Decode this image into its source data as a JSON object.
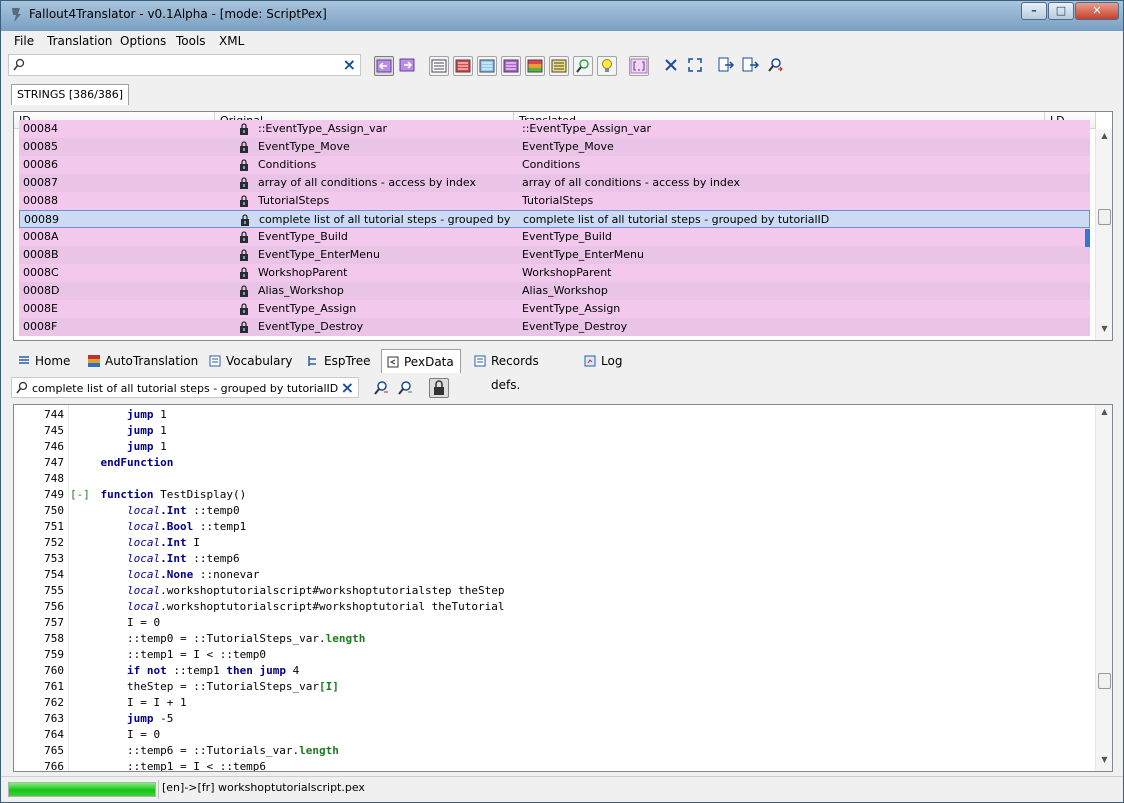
{
  "window": {
    "title": "Fallout4Translator - v0.1Alpha - [mode: ScriptPex]"
  },
  "menu": [
    "File",
    "Translation",
    "Options",
    "Tools",
    "XML"
  ],
  "search": {
    "value": "",
    "placeholder": ""
  },
  "strings_tab": "STRINGS [386/386]",
  "grid": {
    "columns": [
      "ID",
      "Original",
      "Translated",
      "LD"
    ],
    "rows": [
      {
        "id": "00084",
        "original": "::EventType_Assign_var",
        "translated": "::EventType_Assign_var"
      },
      {
        "id": "00085",
        "original": "EventType_Move",
        "translated": "EventType_Move"
      },
      {
        "id": "00086",
        "original": "Conditions",
        "translated": "Conditions"
      },
      {
        "id": "00087",
        "original": "array of all conditions - access by index",
        "translated": "array of all conditions - access by index"
      },
      {
        "id": "00088",
        "original": "TutorialSteps",
        "translated": "TutorialSteps"
      },
      {
        "id": "00089",
        "original": "complete list of all tutorial steps - grouped by tut...",
        "translated": "complete list of all tutorial steps - grouped by tutorialID"
      },
      {
        "id": "0008A",
        "original": "EventType_Build",
        "translated": "EventType_Build"
      },
      {
        "id": "0008B",
        "original": "EventType_EnterMenu",
        "translated": "EventType_EnterMenu"
      },
      {
        "id": "0008C",
        "original": "WorkshopParent",
        "translated": "WorkshopParent"
      },
      {
        "id": "0008D",
        "original": "Alias_Workshop",
        "translated": "Alias_Workshop"
      },
      {
        "id": "0008E",
        "original": "EventType_Assign",
        "translated": "EventType_Assign"
      },
      {
        "id": "0008F",
        "original": "EventType_Destroy",
        "translated": "EventType_Destroy"
      }
    ],
    "selected_id": "00089"
  },
  "tabs": [
    {
      "label": "Home",
      "icon": "home-icon"
    },
    {
      "label": "AutoTranslation",
      "icon": "autotranslation-icon"
    },
    {
      "label": "Vocabulary",
      "icon": "vocabulary-icon"
    },
    {
      "label": "EspTree",
      "icon": "esptree-icon"
    },
    {
      "label": "PexData",
      "icon": "pexdata-icon"
    },
    {
      "label": "Records defs.",
      "icon": "records-icon"
    },
    {
      "label": "Log",
      "icon": "log-icon"
    }
  ],
  "active_tab": "PexData",
  "pex_search": {
    "value": "complete list of all tutorial steps - grouped by tutorialID"
  },
  "code": [
    {
      "n": "744",
      "fold": "",
      "segs": [
        [
          "p",
          "        "
        ],
        [
          "k",
          "jump"
        ],
        [
          "p",
          " 1"
        ]
      ]
    },
    {
      "n": "745",
      "fold": "",
      "segs": [
        [
          "p",
          "        "
        ],
        [
          "k",
          "jump"
        ],
        [
          "p",
          " 1"
        ]
      ]
    },
    {
      "n": "746",
      "fold": "",
      "segs": [
        [
          "p",
          "        "
        ],
        [
          "k",
          "jump"
        ],
        [
          "p",
          " 1"
        ]
      ]
    },
    {
      "n": "747",
      "fold": "",
      "segs": [
        [
          "p",
          "    "
        ],
        [
          "k",
          "endFunction"
        ]
      ]
    },
    {
      "n": "748",
      "fold": "",
      "segs": []
    },
    {
      "n": "749",
      "fold": "[-]",
      "segs": [
        [
          "p",
          "    "
        ],
        [
          "k",
          "function"
        ],
        [
          "p",
          " TestDisplay()"
        ]
      ]
    },
    {
      "n": "750",
      "fold": "",
      "segs": [
        [
          "p",
          "        "
        ],
        [
          "i",
          "local"
        ],
        [
          "k",
          ".Int"
        ],
        [
          "p",
          " ::temp0"
        ]
      ]
    },
    {
      "n": "751",
      "fold": "",
      "segs": [
        [
          "p",
          "        "
        ],
        [
          "i",
          "local"
        ],
        [
          "k",
          ".Bool"
        ],
        [
          "p",
          " ::temp1"
        ]
      ]
    },
    {
      "n": "752",
      "fold": "",
      "segs": [
        [
          "p",
          "        "
        ],
        [
          "i",
          "local"
        ],
        [
          "k",
          ".Int"
        ],
        [
          "p",
          " I"
        ]
      ]
    },
    {
      "n": "753",
      "fold": "",
      "segs": [
        [
          "p",
          "        "
        ],
        [
          "i",
          "local"
        ],
        [
          "k",
          ".Int"
        ],
        [
          "p",
          " ::temp6"
        ]
      ]
    },
    {
      "n": "754",
      "fold": "",
      "segs": [
        [
          "p",
          "        "
        ],
        [
          "i",
          "local"
        ],
        [
          "k",
          ".None"
        ],
        [
          "p",
          " ::nonevar"
        ]
      ]
    },
    {
      "n": "755",
      "fold": "",
      "segs": [
        [
          "p",
          "        "
        ],
        [
          "i",
          "local"
        ],
        [
          "p",
          ".workshoptutorialscript#workshoptutorialstep theStep"
        ]
      ]
    },
    {
      "n": "756",
      "fold": "",
      "segs": [
        [
          "p",
          "        "
        ],
        [
          "i",
          "local"
        ],
        [
          "p",
          ".workshoptutorialscript#workshoptutorial theTutorial"
        ]
      ]
    },
    {
      "n": "757",
      "fold": "",
      "segs": [
        [
          "p",
          "        I = 0"
        ]
      ]
    },
    {
      "n": "758",
      "fold": "",
      "segs": [
        [
          "p",
          "        ::temp0 = ::TutorialSteps_var."
        ],
        [
          "g",
          "length"
        ]
      ]
    },
    {
      "n": "759",
      "fold": "",
      "segs": [
        [
          "p",
          "        ::temp1 = I < ::temp0"
        ]
      ]
    },
    {
      "n": "760",
      "fold": "",
      "segs": [
        [
          "p",
          "        "
        ],
        [
          "k",
          "if not"
        ],
        [
          "p",
          " ::temp1 "
        ],
        [
          "k",
          "then jump"
        ],
        [
          "p",
          " 4"
        ]
      ]
    },
    {
      "n": "761",
      "fold": "",
      "segs": [
        [
          "p",
          "        theStep = ::TutorialSteps_var"
        ],
        [
          "g",
          "[I]"
        ]
      ]
    },
    {
      "n": "762",
      "fold": "",
      "segs": [
        [
          "p",
          "        I = I + 1"
        ]
      ]
    },
    {
      "n": "763",
      "fold": "",
      "segs": [
        [
          "p",
          "        "
        ],
        [
          "k",
          "jump"
        ],
        [
          "p",
          " -5"
        ]
      ]
    },
    {
      "n": "764",
      "fold": "",
      "segs": [
        [
          "p",
          "        I = 0"
        ]
      ]
    },
    {
      "n": "765",
      "fold": "",
      "segs": [
        [
          "p",
          "        ::temp6 = ::Tutorials_var."
        ],
        [
          "g",
          "length"
        ]
      ]
    },
    {
      "n": "766",
      "fold": "",
      "segs": [
        [
          "p",
          "        ::temp1 = I < ::temp6"
        ]
      ]
    }
  ],
  "status": {
    "progress": 1.0,
    "text": "[en]->[fr] workshoptutorialscript.pex"
  }
}
